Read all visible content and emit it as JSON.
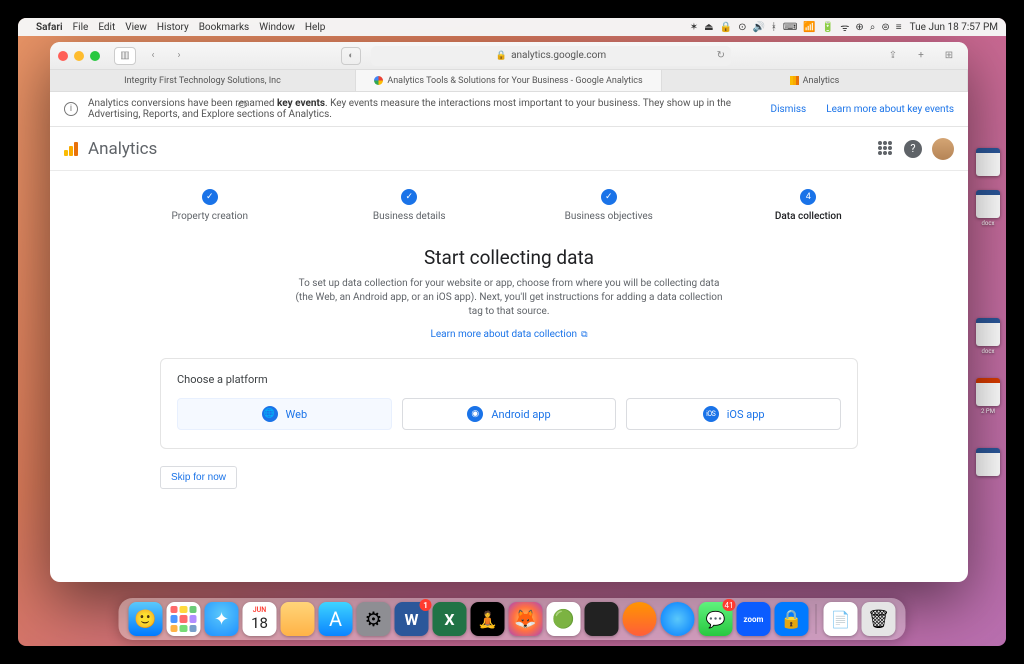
{
  "menubar": {
    "app": "Safari",
    "items": [
      "File",
      "Edit",
      "View",
      "History",
      "Bookmarks",
      "Window",
      "Help"
    ],
    "clock": "Tue Jun 18  7:57 PM"
  },
  "browser": {
    "url": "analytics.google.com",
    "tabs": [
      {
        "label": "Integrity First Technology Solutions, Inc"
      },
      {
        "label": "Analytics Tools & Solutions for Your Business - Google Analytics"
      },
      {
        "label": "Analytics"
      }
    ]
  },
  "banner": {
    "text_pre": "Analytics conversions have been renamed ",
    "text_bold": "key events",
    "text_post": ". Key events measure the interactions most important to your business. They show up in the Advertising, Reports, and Explore sections of Analytics.",
    "dismiss": "Dismiss",
    "learn": "Learn more about key events"
  },
  "app_header": {
    "title": "Analytics"
  },
  "stepper": {
    "steps": [
      {
        "label": "Property creation",
        "state": "done"
      },
      {
        "label": "Business details",
        "state": "done"
      },
      {
        "label": "Business objectives",
        "state": "done"
      },
      {
        "label": "Data collection",
        "state": "current",
        "num": "4"
      }
    ]
  },
  "main": {
    "title": "Start collecting data",
    "desc": "To set up data collection for your website or app, choose from where you will be collecting data (the Web, an Android app, or an iOS app). Next, you'll get instructions for adding a data collection tag to that source.",
    "learn": "Learn more about data collection"
  },
  "card": {
    "title": "Choose a platform",
    "platforms": [
      {
        "label": "Web",
        "icon": "globe",
        "selected": true
      },
      {
        "label": "Android app",
        "icon": "android"
      },
      {
        "label": "iOS app",
        "icon": "ios"
      }
    ]
  },
  "skip": {
    "label": "Skip for now"
  },
  "dock_badges": {
    "calendar_day": "18",
    "calendar_month": "JUN",
    "word": "1",
    "messages": "41"
  }
}
